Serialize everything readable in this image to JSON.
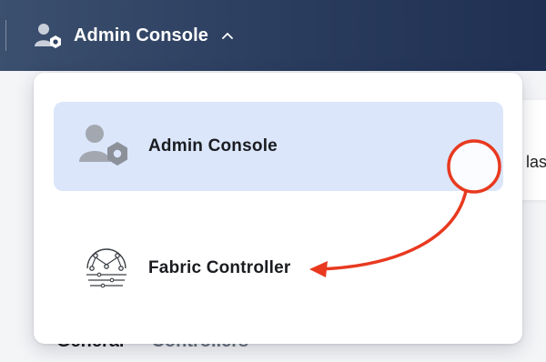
{
  "header": {
    "current_app_label": "Admin Console"
  },
  "background": {
    "card_text": "las",
    "tabs": [
      {
        "label": "General"
      },
      {
        "label": "Controllers"
      }
    ]
  },
  "dropdown": {
    "items": [
      {
        "label": "Admin Console",
        "icon": "admin-console-icon",
        "selected": true
      },
      {
        "label": "Fabric Controller",
        "icon": "fabric-controller-icon",
        "selected": false
      }
    ]
  },
  "colors": {
    "header_gradient_start": "#3b4f6e",
    "header_gradient_end": "#1f3052",
    "selected_item_bg": "#dbe6fb",
    "annotation_red": "#e8391f"
  }
}
